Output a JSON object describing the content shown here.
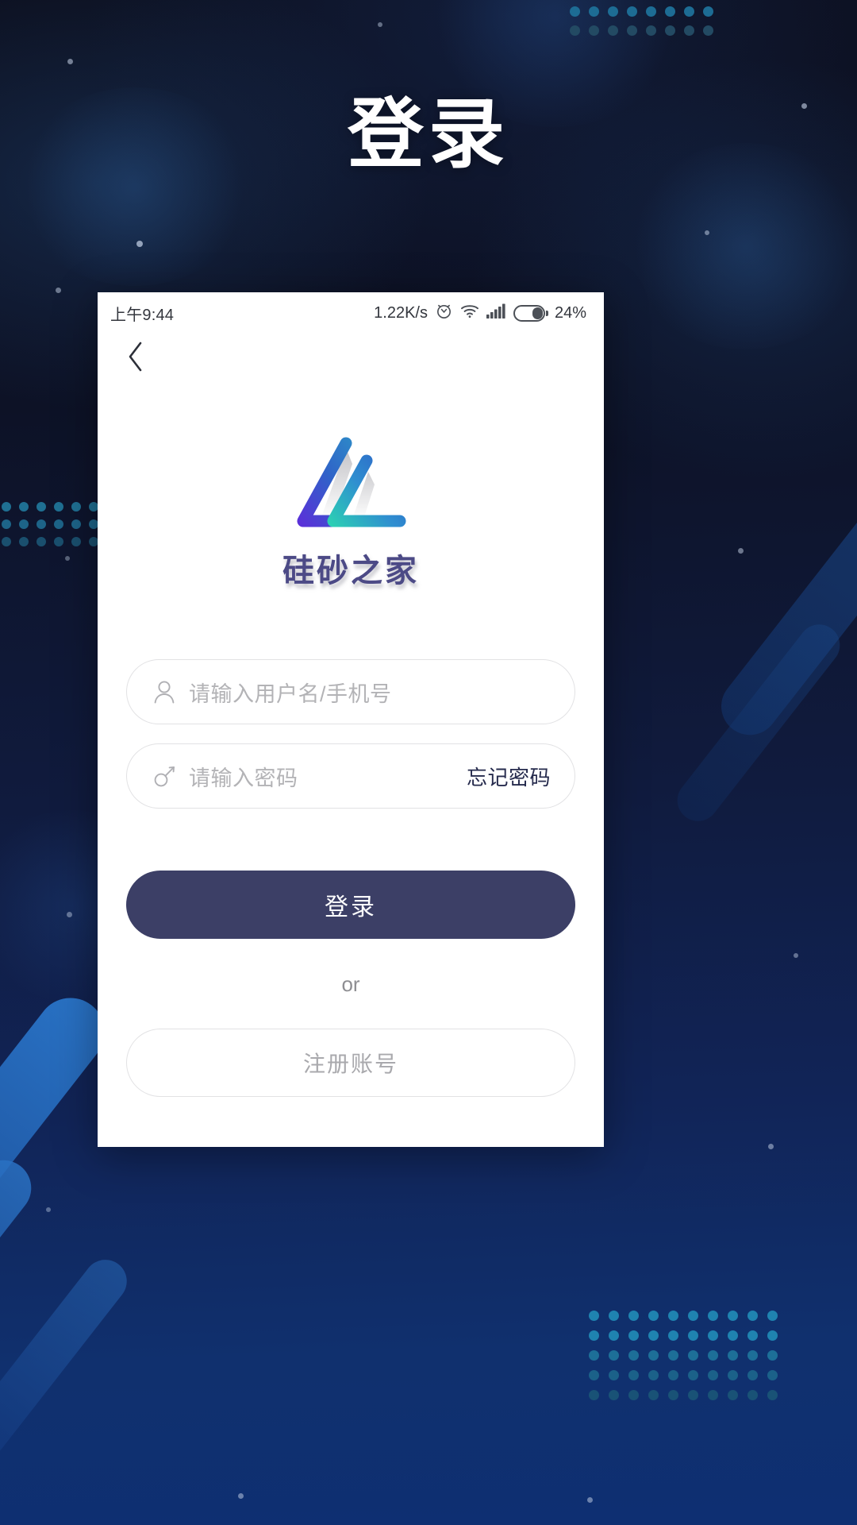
{
  "page": {
    "title": "登录",
    "background_colors": {
      "deep_navy": "#0c0f1e",
      "mid_navy": "#101b3e",
      "royal_blue": "#0e2f72",
      "dot_teal": "#1d6c94",
      "dot_muted": "#234a63",
      "ribbon_blue": "#1a4f96"
    }
  },
  "phone": {
    "statusbar": {
      "clock": "上午9:44",
      "net_speed": "1.22K/s",
      "alarm_icon": "alarm-clock-icon",
      "wifi_icon": "wifi-icon",
      "signal_icon": "cellular-signal-icon",
      "battery_icon": "battery-icon",
      "battery_percent": "24%"
    },
    "navbar": {
      "back_icon": "chevron-left-icon"
    },
    "brand": {
      "logo_icon": "triangle-logo-icon",
      "name": "硅砂之家",
      "name_color": "#4c4a86",
      "logo_gradient_start": "#5b30d8",
      "logo_gradient_mid": "#2f63c8",
      "logo_gradient_end": "#2fd0b4"
    },
    "form": {
      "username": {
        "icon": "user-icon",
        "placeholder": "请输入用户名/手机号",
        "value": ""
      },
      "password": {
        "icon": "key-icon",
        "placeholder": "请输入密码",
        "value": "",
        "forgot_label": "忘记密码"
      },
      "login_label": "登录",
      "login_button_color": "#3c3f66",
      "or_label": "or",
      "register_label": "注册账号"
    }
  }
}
